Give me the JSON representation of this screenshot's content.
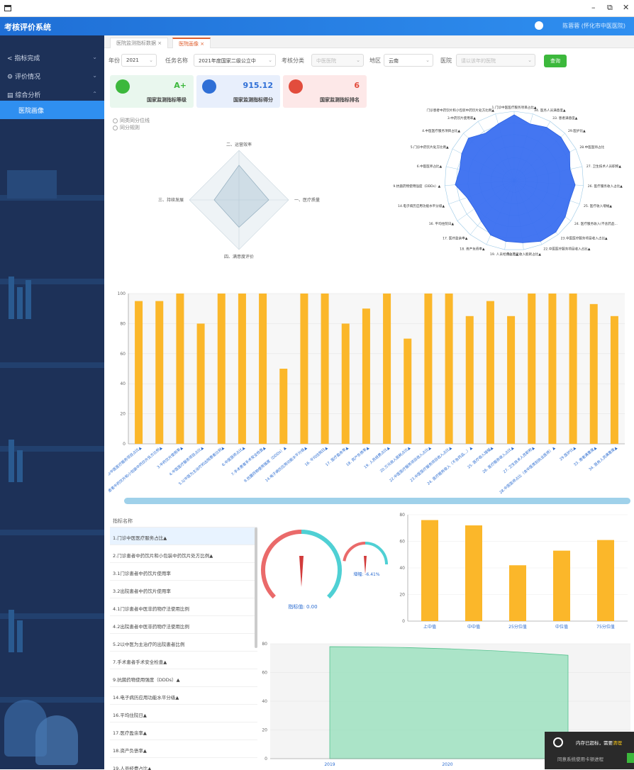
{
  "window": {
    "min": "–",
    "restore": "⧉",
    "close": "✕"
  },
  "app": {
    "title": "考核评价系统",
    "user": "陈蓉蓉 (怀化市中医医院)"
  },
  "sidebar": {
    "items": [
      {
        "label": "指标完成",
        "icon": "share-icon"
      },
      {
        "label": "评价情况",
        "icon": "settings-icon"
      },
      {
        "label": "综合分析",
        "icon": "calendar-icon"
      },
      {
        "label": "医院画像",
        "icon": ""
      }
    ]
  },
  "tabs": [
    {
      "label": "医院监测指标数据"
    },
    {
      "label": "医院画像"
    }
  ],
  "filters": {
    "year_label": "年份",
    "year": "2021",
    "task_label": "任务名称",
    "task": "2021年度国家二级公立中",
    "cat_label": "考核分类",
    "cat": "中医医院",
    "region_label": "地区",
    "region": "云南",
    "hosp_label": "医院",
    "hosp": "请以该年的医院",
    "query": "查询"
  },
  "cards": [
    {
      "value": "A+",
      "label": "国家监测指标等级",
      "color": "#3cb83c",
      "bg": "#e9f7ee"
    },
    {
      "value": "915.12",
      "label": "国家监测指标得分",
      "color": "#2f6fd6",
      "bg": "#e8effc"
    },
    {
      "value": "6",
      "label": "国家监测指标排名",
      "color": "#e24c3c",
      "bg": "#fde8e8"
    }
  ],
  "radios": [
    "同类同分位线",
    "同分规则"
  ],
  "diamond": {
    "labels": [
      "二、运营效率",
      "一、医疗质量",
      "四、满意度评价",
      "三、持续发展"
    ],
    "values": [
      0.7,
      0.6,
      0.55,
      0.5
    ]
  },
  "radar_labels": [
    "1.门诊中医医疗服务项目占比▲",
    "34. 医务人员满意度▲",
    "33. 患者满意度▲",
    "29.医护比▲",
    "28.中医医师占比",
    "27. 卫生技术人员职称▲",
    "26. 医疗服务收入占比▲",
    "25. 医疗收入增幅▲",
    "24. 医疗服务收入(不含药品...",
    "23.中医医疗服务项目收入占比▲",
    "22.中医医疗服务项目收入占比▲",
    "20.万元收入能耗占比▲",
    "19. 人员经费占比▲",
    "18. 资产负债率▲",
    "17. 医疗盈余率▲",
    "16. 平均住院日▲",
    "14.电子病历应用功能水平分级▲",
    "9.抗菌药物使用强度（DDDs）▲",
    "6.中医医师占比▲",
    "5.门诊中药饮片处方比例▲",
    "4.中医医疗服务项目占比▲",
    "3.中药饮片使用率▲",
    "门诊患者中药饮片和小包装中药饮片处方比例▲"
  ],
  "radar_values": [
    0.95,
    0.85,
    0.9,
    0.92,
    0.9,
    0.82,
    0.88,
    0.85,
    0.9,
    0.95,
    0.95,
    0.9,
    0.88,
    0.85,
    0.75,
    0.7,
    0.72,
    0.85,
    0.8,
    0.85,
    0.9,
    0.8,
    0.85
  ],
  "chart_data": [
    {
      "type": "bar",
      "title": "",
      "ylim": [
        0,
        100
      ],
      "yticks": [
        "0",
        "20",
        "40",
        "60",
        "80",
        "100"
      ],
      "categories": [
        "1.门诊中医医疗服务项目占比▲",
        "2.门诊患者中药饮片和小包装中药饮片处方比例▲",
        "3.中药饮片使用率▲",
        "4.中医医疗服务项目占比▲",
        "5.以中医为主治疗的出院患者比例▲",
        "6.中医医师占比▲",
        "7.手术患者手术安全检查▲",
        "9.抗菌药物使用强度（DDDs）▲",
        "14.电子病历应用功能水平分级▲",
        "16. 平均住院日▲",
        "17. 医疗盈余率▲",
        "18. 资产负债率▲",
        "19. 人员经费占比▲",
        "20.万元收入能耗占比▲",
        "22.中医医疗服务项目收入占比▲",
        "23.中医医疗服务项目收入占比▲",
        "24. 医疗服务收入（不含药品...）▲",
        "25. 医疗收入增幅▲",
        "26. 医疗服务收入占比▲",
        "27. 卫生技术人员职称▲",
        "28.中医医师占比（含中医类别执业医师）▲",
        "29.医护比▲",
        "33. 患者满意度▲",
        "34. 医务人员满意度▲"
      ],
      "values": [
        95,
        95,
        100,
        80,
        100,
        100,
        100,
        50,
        100,
        100,
        80,
        90,
        100,
        70,
        100,
        100,
        85,
        95,
        85,
        100,
        100,
        100,
        93,
        85
      ]
    },
    {
      "type": "bar",
      "ylim": [
        0,
        80
      ],
      "yticks": [
        "0",
        "20",
        "40",
        "60",
        "80"
      ],
      "categories": [
        "上中值",
        "中中值",
        "25分位值",
        "中位值",
        "75分位值"
      ],
      "values": [
        76,
        72,
        42,
        53,
        61
      ]
    },
    {
      "type": "area",
      "ylim": [
        0,
        80
      ],
      "yticks": [
        "0",
        "20",
        "40",
        "60",
        "80"
      ],
      "x": [
        "2019",
        "2020"
      ],
      "values": [
        78,
        72
      ]
    }
  ],
  "gauges": [
    {
      "label": "指标值: 0.00"
    },
    {
      "label": "增幅: -6.41%"
    }
  ],
  "list": {
    "header": "指标名称",
    "items": [
      "1.门诊中医医疗服务占比▲",
      "2.门诊患者中药饮片和小包装中药饮片处方比例▲",
      "3.1门诊患者中药饮片使用率",
      "3.2出院患者中药饮片使用率",
      "4.1门诊患者中医非药物疗法使用比例",
      "4.2出院患者中医非药物疗法使用比例",
      "5.2以中医为主治疗的出院患者比例",
      "7.手术患者手术安全检查▲",
      "9.抗菌药物使用强度（DDDs）▲",
      "14.电子病历应用功能水平分级▲",
      "16.平均住院日▲",
      "17.医疗盈余率▲",
      "18.资产负债率▲",
      "19.人员经费占比▲"
    ]
  },
  "toast": {
    "t1": "内存已超标，需要",
    "t1b": "清理",
    "t2": "同意系统使用卡顿进程"
  }
}
